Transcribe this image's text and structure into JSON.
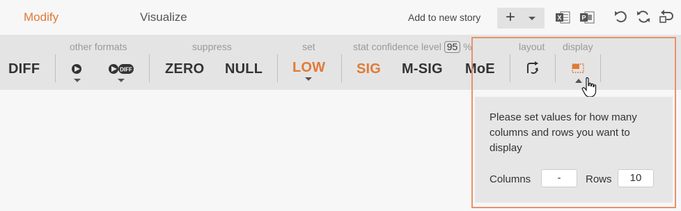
{
  "tabs": {
    "modify": "Modify",
    "visualize": "Visualize"
  },
  "toolbar": {
    "add_to_story": "Add to new story",
    "plus": "+"
  },
  "ribbon": {
    "diff": "DIFF",
    "other_formats_label": "other formats",
    "suppress_label": "suppress",
    "zero": "ZERO",
    "null": "NULL",
    "set_label": "set",
    "low": "LOW",
    "stat_conf_label": "stat confidence level",
    "confidence_value": "95",
    "percent": "%",
    "sig": "SIG",
    "msig": "M-SIG",
    "moe": "MoE",
    "layout_label": "layout",
    "display_label": "display"
  },
  "popup": {
    "message": "Please set values for how many columns and rows you want to display",
    "columns_label": "Columns",
    "columns_value": "-",
    "rows_label": "Rows",
    "rows_value": "10"
  },
  "colors": {
    "accent": "#e07a35",
    "highlight_border": "#e8916b"
  }
}
